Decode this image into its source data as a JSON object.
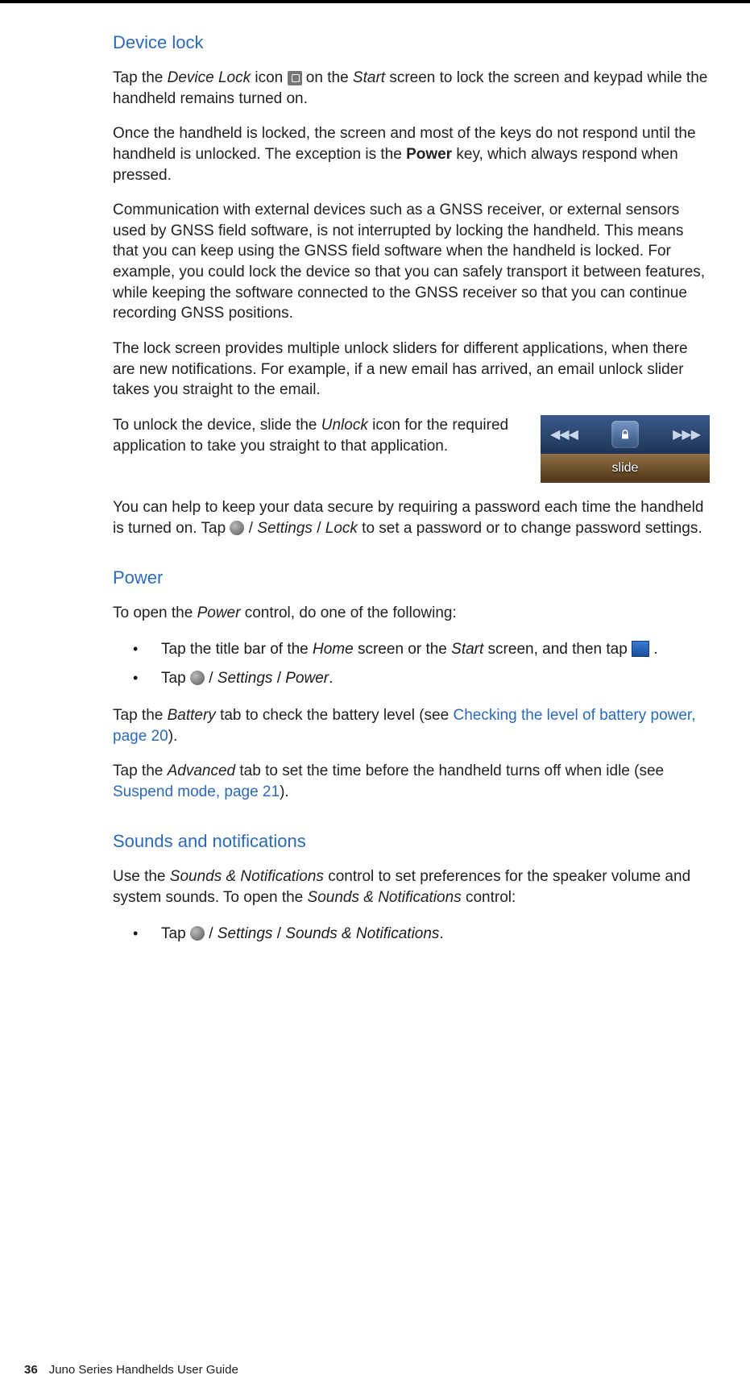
{
  "section1": {
    "heading": "Device lock",
    "p1_before": "Tap the ",
    "p1_italic1": "Device Lock",
    "p1_mid1": " icon ",
    "p1_mid2": " on the ",
    "p1_italic2": "Start",
    "p1_after": " screen to lock the screen and keypad while the handheld remains turned on.",
    "p2_a": "Once the handheld is locked, the screen and most of the keys do not respond until the handheld is unlocked. The exception is the ",
    "p2_bold": "Power",
    "p2_b": " key, which always respond when pressed.",
    "p3": "Communication with external devices such as a GNSS receiver, or external sensors used by GNSS field software, is not interrupted by locking the handheld. This means that you can keep using the GNSS field software when the handheld is locked. For example, you could lock the device so that you can safely transport it between features, while keeping the software connected to the GNSS receiver so that you can continue recording GNSS positions.",
    "p4": "The lock screen provides multiple unlock sliders for different applications, when there are new notifications. For example, if a new email has arrived, an email unlock slider takes you straight to the email.",
    "p5_a": "To unlock the device, slide the ",
    "p5_italic": "Unlock",
    "p5_b": " icon for the required application to take you straight to that application.",
    "slider_caption": "slide",
    "p6_a": "You can help to keep your data secure by requiring a password each time the handheld is turned on. Tap ",
    "p6_b": " / ",
    "p6_i1": "Settings",
    "p6_c": " / ",
    "p6_i2": "Lock",
    "p6_d": " to set a password or to change password settings."
  },
  "section2": {
    "heading": "Power",
    "p1_a": "To open the ",
    "p1_i": "Power",
    "p1_b": " control, do one of the following:",
    "li1_a": "Tap the title bar of the ",
    "li1_i1": "Home",
    "li1_b": " screen or the ",
    "li1_i2": "Start",
    "li1_c": " screen, and then tap ",
    "li1_d": " .",
    "li2_a": "Tap ",
    "li2_b": " / ",
    "li2_i1": "Settings",
    "li2_c": " / ",
    "li2_i2": "Power",
    "li2_d": ".",
    "p2_a": "Tap the ",
    "p2_i": "Battery",
    "p2_b": " tab to check the battery level (see ",
    "p2_link": "Checking the level of battery power, page 20",
    "p2_c": ").",
    "p3_a": "Tap the ",
    "p3_i": "Advanced",
    "p3_b": " tab to set the time before the handheld turns off when idle (see ",
    "p3_link": "Suspend mode, page 21",
    "p3_c": ")."
  },
  "section3": {
    "heading": "Sounds and notifications",
    "p1_a": "Use the ",
    "p1_i1": "Sounds & Notifications",
    "p1_b": " control to set preferences for the speaker volume and system sounds. To open the ",
    "p1_i2": "Sounds & Notifications",
    "p1_c": " control:",
    "li1_a": "Tap ",
    "li1_b": " / ",
    "li1_i1": "Settings",
    "li1_c": " / ",
    "li1_i2": "Sounds & Notifications",
    "li1_d": "."
  },
  "footer": {
    "pagenum": "36",
    "title": "Juno Series Handhelds User Guide"
  }
}
